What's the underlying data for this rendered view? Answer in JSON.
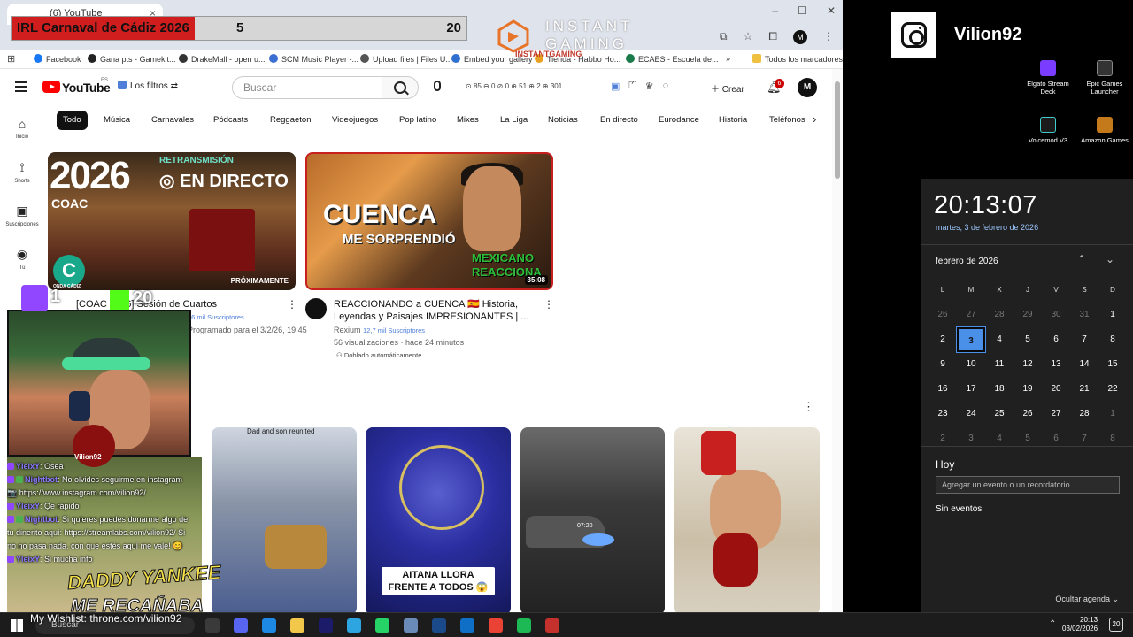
{
  "browser": {
    "tab_title": "(6) YouTube",
    "tab_close": "×",
    "window_buttons": [
      "–",
      "☐",
      "✕"
    ],
    "bookmarks": [
      "Facebook",
      "Gana pts - Gamekit...",
      "DrakeMall - open u...",
      "SCM Music Player -...",
      "Upload files | Files U...",
      "Embed your gallery",
      "Tienda - Habbo Ho...",
      "ECAES - Escuela de...",
      "»",
      "Todos los marcadores"
    ]
  },
  "stream_overlay": {
    "title": "IRL Carnaval de Cádiz 2026",
    "count_left": "5",
    "count_right": "20",
    "sponsor": "INSTANT GAMING",
    "sponsor_sub": "INSTANTGAMING",
    "twitch_count": "1",
    "kick_count": "20",
    "streamer_tag": "Vilion92",
    "overlay_text_1": "DADDY YANKEE",
    "overlay_text_2": "ME RECAÑABA",
    "wishlist": "My Wishlist: throne.com/vilion92"
  },
  "chat": [
    {
      "user": "YleixY",
      "text": ": Osea"
    },
    {
      "user": "Nightbot",
      "text": ": No olvides seguirme en instagram 📷 https://www.instagram.com/vilion92/"
    },
    {
      "user": "YleixY",
      "text": ": Qe rápido"
    },
    {
      "user": "Nightbot",
      "text": ": Si quieres puedes donarme algo de tu dinerito aquí: https://streamlabs.com/vilion92/ Si no no pasa nada, con que estés aquí me vale! 😊"
    },
    {
      "user": "YleixY",
      "text": ": Si mucha info"
    }
  ],
  "youtube": {
    "logo_text": "YouTube",
    "region": "ES",
    "filters_label": "Los filtros",
    "search_placeholder": "Buscar",
    "stats": "85 ⊖ 0 ⊘ 0 ⊕ 51 ⊕ 2 ⊕ 301",
    "create_label": "Crear",
    "notif_count": "6",
    "avatar_letter": "M",
    "chips": [
      "Todo",
      "Música",
      "Carnavales",
      "Pódcasts",
      "Reggaeton",
      "Videojuegos",
      "Pop latino",
      "Mixes",
      "La Liga",
      "Noticias",
      "En directo",
      "Eurodance",
      "Historia",
      "Teléfonos"
    ],
    "sidebar": [
      {
        "label": "Inicio",
        "icon": "home-icon"
      },
      {
        "label": "Shorts",
        "icon": "shorts-icon"
      },
      {
        "label": "Suscripciones",
        "icon": "subscriptions-icon"
      },
      {
        "label": "Tú",
        "icon": "you-icon"
      }
    ],
    "videos": [
      {
        "thumb_year": "2026",
        "thumb_coac": "COAC",
        "thumb_top": "RETRANSMISIÓN",
        "thumb_main": "◎ EN DIRECTO",
        "thumb_badge": "PRÓXIMAMENTE",
        "thumb_logo": "C",
        "thumb_logo_caption": "ONDA CÁDIZ",
        "title": "[COAC 2026] Sesión de Cuartos",
        "subs": "56 mil Suscriptores",
        "meta": "Programado para el 3/2/26, 19:45"
      },
      {
        "thumb_main": "CUENCA",
        "thumb_sub": "ME SORPRENDIÓ",
        "thumb_tag": "MEXICANO REACCIONA",
        "duration": "35:08",
        "title": "REACCIONANDO a CUENCA 🇪🇸 Historia, Leyendas y Paisajes IMPRESIONANTES | ...",
        "channel": "Rexium",
        "subs": "12,7 mil Suscriptores",
        "meta": "56 visualizaciones · hace 24 minutos",
        "dub": "Doblado automáticamente"
      }
    ],
    "shorts": [
      {
        "caption": "Dad and son reunited"
      },
      {
        "caption": "AITANA LLORA FRENTE A TODOS 😱"
      },
      {
        "caption": "07:20"
      },
      {
        "caption": ""
      }
    ]
  },
  "desktop": {
    "instagram_name": "Vilion92",
    "icons": [
      {
        "label": "Elgato Stream Deck",
        "color": "#7a3cff"
      },
      {
        "label": "Epic Games Launcher",
        "color": "#222222"
      },
      {
        "label": "Voicemod V3",
        "color": "#1b1b1b"
      },
      {
        "label": "Amazon Games",
        "color": "#c47a1a"
      }
    ]
  },
  "calendar": {
    "time": "20:13:07",
    "date_long": "martes, 3 de febrero de 2026",
    "month": "febrero de 2026",
    "weekdays": [
      "L",
      "M",
      "X",
      "J",
      "V",
      "S",
      "D"
    ],
    "weeks": [
      [
        "26",
        "27",
        "28",
        "29",
        "30",
        "31",
        "1"
      ],
      [
        "2",
        "3",
        "4",
        "5",
        "6",
        "7",
        "8"
      ],
      [
        "9",
        "10",
        "11",
        "12",
        "13",
        "14",
        "15"
      ],
      [
        "16",
        "17",
        "18",
        "19",
        "20",
        "21",
        "22"
      ],
      [
        "23",
        "24",
        "25",
        "26",
        "27",
        "28",
        "1"
      ],
      [
        "2",
        "3",
        "4",
        "5",
        "6",
        "7",
        "8"
      ]
    ],
    "today_label": "Hoy",
    "event_placeholder": "Agregar un evento o un recordatorio",
    "no_events": "Sin eventos",
    "hide_agenda": "Ocultar agenda ⌄"
  },
  "taskbar": {
    "search_label": "Buscar",
    "time": "20:13",
    "date": "03/02/2026",
    "notif_count": "20",
    "app_colors": [
      "#3a3a3a",
      "#5865f2",
      "#1e88e5",
      "#f2c84b",
      "#1b1b6a",
      "#2ca5e0",
      "#25d366",
      "#6a8ab8",
      "#1b4a8a",
      "#0f6fc6",
      "#ea4335",
      "#1db954",
      "#c4302b"
    ]
  }
}
